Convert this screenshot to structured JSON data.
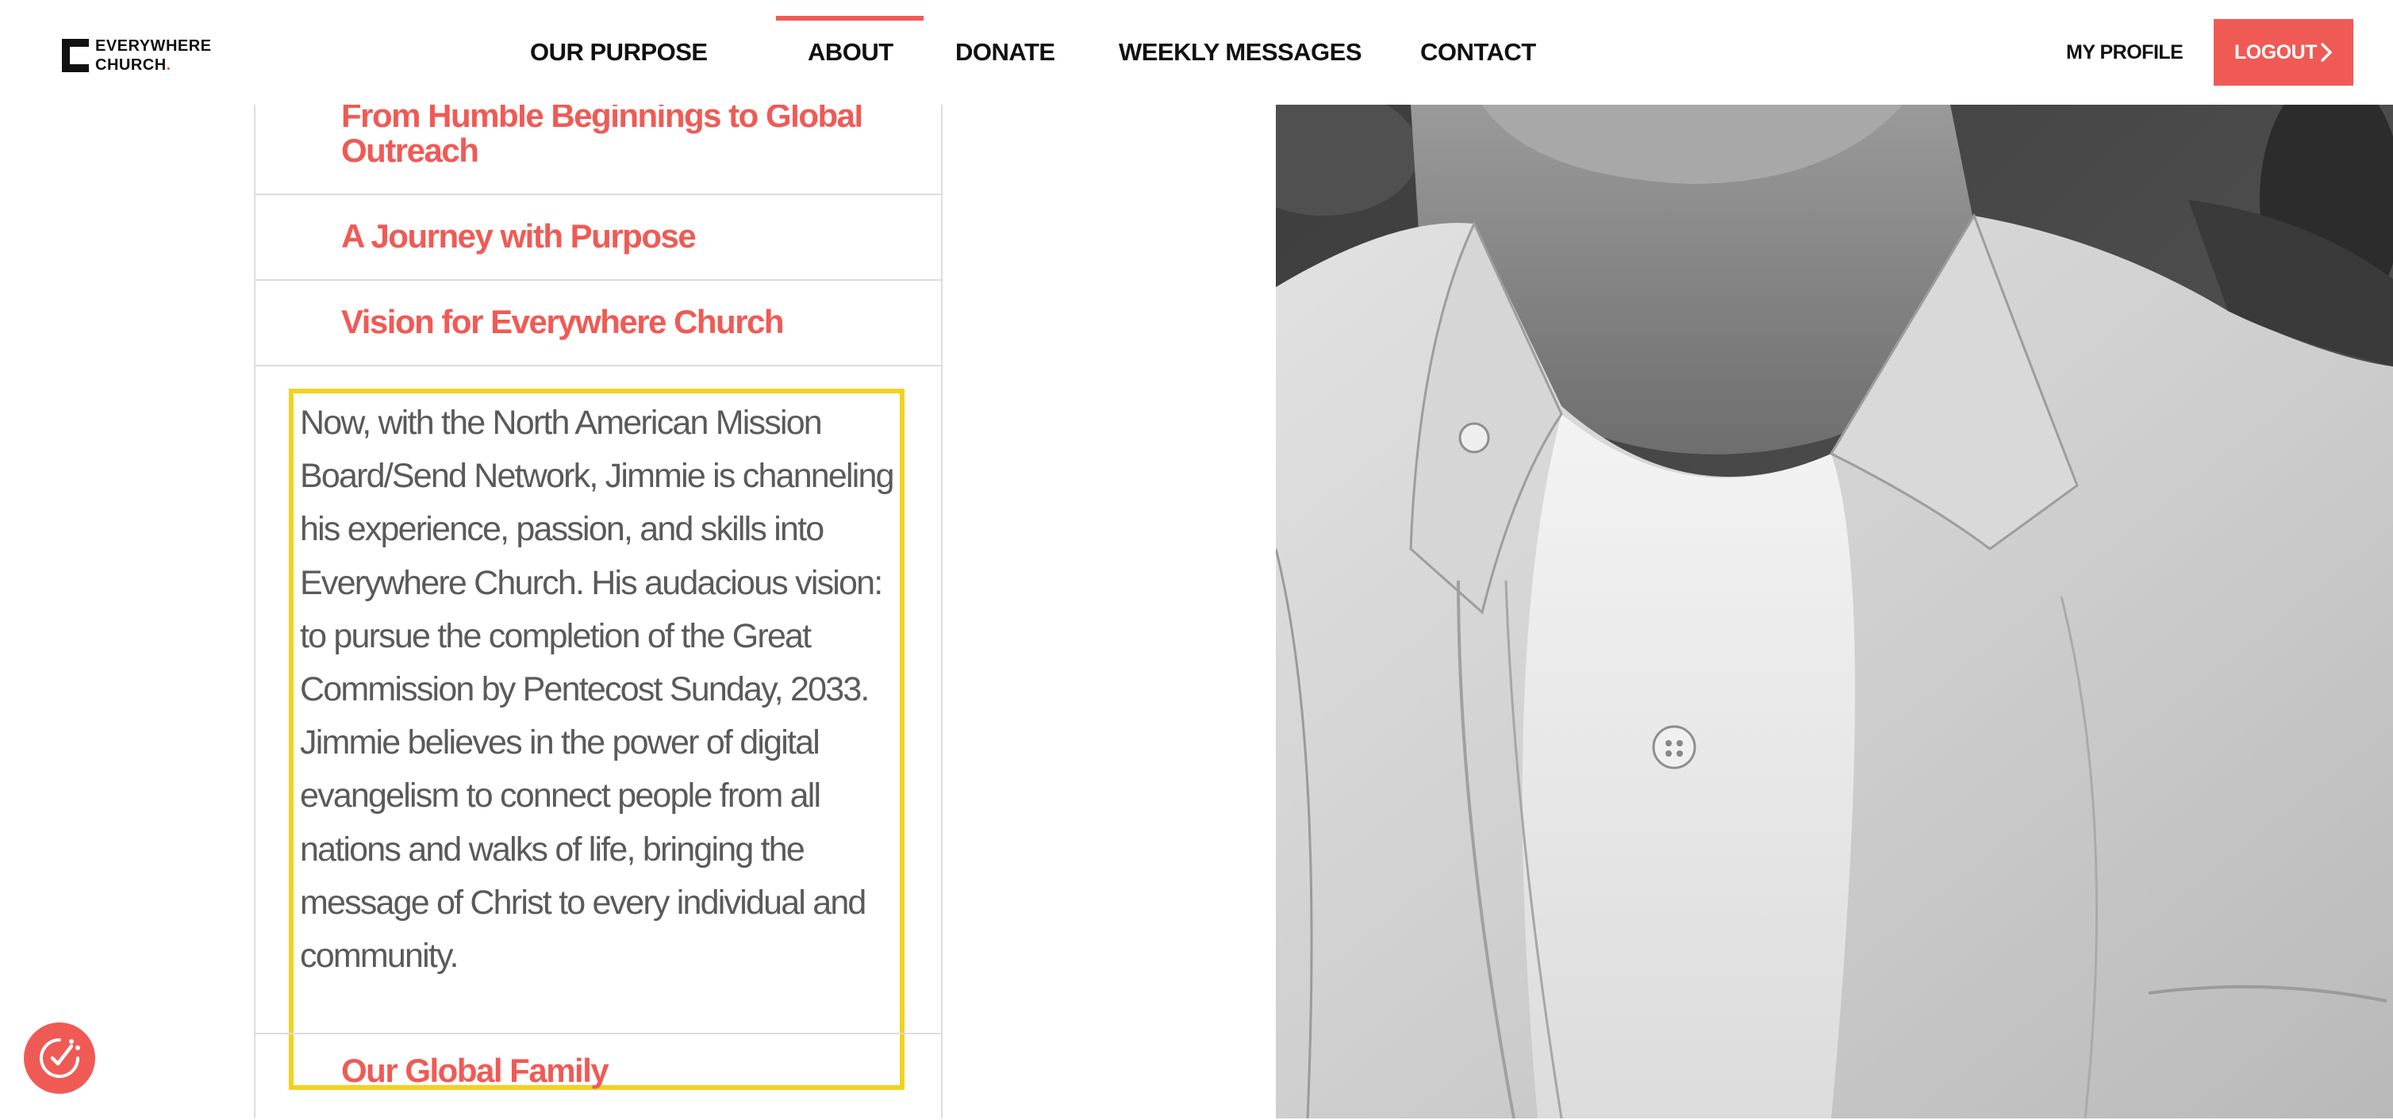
{
  "brand": {
    "line1": "EVERYWHERE",
    "line2": "CHURCH",
    "dot": "."
  },
  "nav": {
    "items": [
      "OUR PURPOSE",
      "ABOUT",
      "DONATE",
      "WEEKLY MESSAGES",
      "CONTACT"
    ],
    "active": "ABOUT",
    "profile": "MY PROFILE",
    "logout": "LOGOUT"
  },
  "accordion": {
    "items": [
      {
        "title": "From Humble Beginnings to Global Outreach"
      },
      {
        "title": "A Journey with Purpose"
      },
      {
        "title": "Vision for Everywhere Church"
      },
      {
        "title": "Our Global Family"
      }
    ],
    "open_body": "Now, with the North American Mission Board/Send Network, Jimmie is channeling his experience, passion, and skills into Everywhere Church. His audacious vision: to pursue the completion of the Great Commission by Pentecost Sunday, 2033. Jimmie believes in the power of digital evangelism to connect people from all nations and walks of life, bringing the message of Christ to every individual and community."
  },
  "icons": {
    "consent": "consent-check-icon",
    "logout_chevron": "chevron-right-icon"
  },
  "colors": {
    "accent": "#f05a55",
    "highlight_border": "#f2d21f",
    "body_text": "#5a5a5a",
    "nav_text": "#111111",
    "divider": "#dedede"
  }
}
